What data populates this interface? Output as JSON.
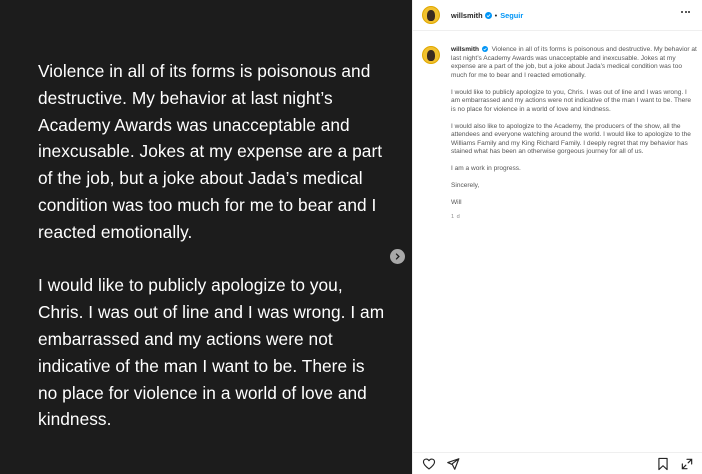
{
  "media": {
    "paragraphs": [
      "Violence in all of its forms is poisonous and destructive. My behavior at last night’s Academy Awards was unacceptable and inexcusable. Jokes at my expense are a part of the job, but a joke about Jada’s medical condition was too much for me to bear and I reacted emotionally.",
      "I would like to publicly apologize to you, Chris. I was out of line and I was wrong. I am embarrassed and my actions were not indicative of the man I want to be. There is no place for violence in a world of love and kindness."
    ]
  },
  "header": {
    "username": "willsmith",
    "separator": "•",
    "follow_label": "Seguir"
  },
  "caption": {
    "username": "willsmith",
    "paragraphs": [
      "Violence in all of its forms is poisonous and destructive. My behavior at last night’s Academy Awards was unacceptable and inexcusable. Jokes at my expense are a part of the job, but a joke about Jada’s medical condition was too much for me to bear and I reacted emotionally.",
      "I would like to publicly apologize to you, Chris. I was out of line and I was wrong. I am embarrassed and my actions were not indicative of the man I want to be. There is no place for violence in a world of love and kindness.",
      "I would also like to apologize to the Academy, the producers of the show, all the attendees and everyone watching around the world. I would like to apologize to the Williams Family and my King Richard Family. I deeply regret that my behavior has stained what has been an otherwise gorgeous journey for all of us.",
      "I am a work in progress.",
      "Sincerely,",
      "Will"
    ],
    "time": "1 d"
  },
  "icons": {
    "next": "chevron-right-icon",
    "verified": "verified-badge-icon",
    "more": "more-options-icon",
    "like": "heart-icon",
    "share": "send-icon",
    "save": "bookmark-icon",
    "expand": "expand-icon"
  },
  "colors": {
    "media_bg": "#1c1c1c",
    "follow": "#0095f6",
    "verified": "#0095f6"
  }
}
